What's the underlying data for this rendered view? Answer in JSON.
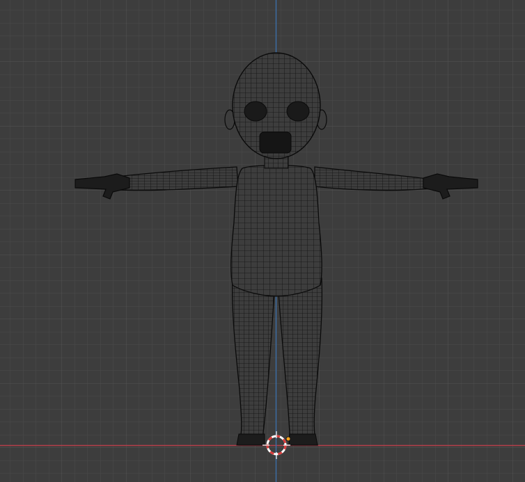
{
  "viewport": {
    "view": "front-orthographic",
    "shading": "wireframe",
    "colors": {
      "background": "#3d3d3d",
      "grid_minor": "#484848",
      "grid_major": "#555555",
      "x_axis": "#b63e4a",
      "z_axis": "#3b6fa8",
      "wire": "#111111",
      "cursor_red": "#d83a3a",
      "cursor_white": "#ffffff",
      "origin": "#ffa41b"
    },
    "objects": [
      {
        "name": "child-base-mesh",
        "type": "mesh",
        "pose": "t-pose"
      }
    ],
    "icons": [
      "3d-cursor-icon",
      "object-origin-icon"
    ]
  }
}
